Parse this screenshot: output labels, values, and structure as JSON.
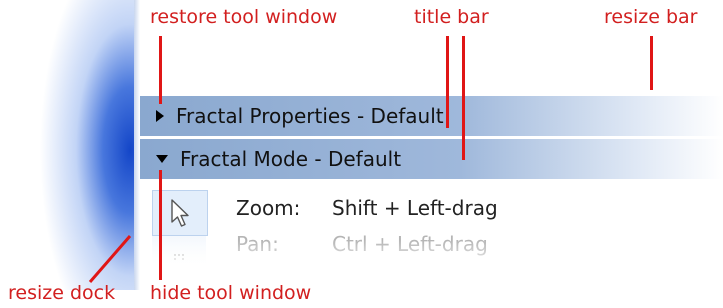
{
  "callouts": {
    "restore_tool_window": "restore tool window",
    "title_bar": "title bar",
    "resize_bar": "resize bar",
    "resize_dock": "resize dock",
    "hide_tool_window": "hide tool window"
  },
  "panels": [
    {
      "title": "Fractal Properties - Default",
      "state": "collapsed"
    },
    {
      "title": "Fractal Mode - Default",
      "state": "expanded"
    }
  ],
  "mode_rows": [
    {
      "label": "Zoom:",
      "value": "Shift + Left-drag"
    },
    {
      "label": "Pan:",
      "value": "Ctrl + Left-drag"
    }
  ],
  "icons": {
    "collapsed_toggle": "triangle-right-icon",
    "expanded_toggle": "triangle-down-icon",
    "tool": "pointer-arrow-icon"
  },
  "colors": {
    "annotation": "#e01616",
    "header_bar": "#8aa8cf",
    "dock_glow": "#1446c8"
  }
}
